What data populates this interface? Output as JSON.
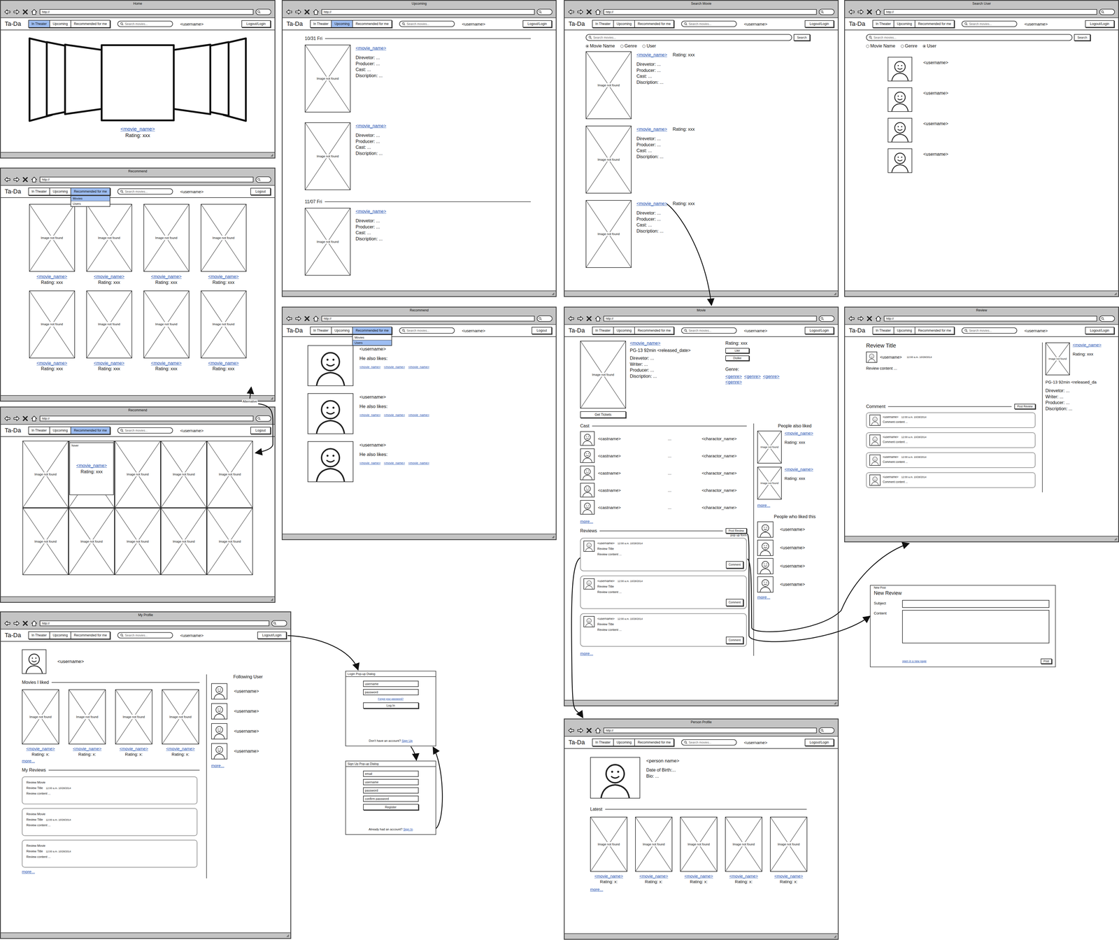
{
  "app": {
    "logo": "Ta-Da",
    "url": "http://",
    "search_placeholder": "Search movies...",
    "username": "<username>",
    "image_placeholder": "Image not found"
  },
  "annotations": {
    "alternative": "Alternative"
  },
  "windows": [
    {
      "kind": "home",
      "title": "Home",
      "tabs": [
        {
          "label": "In Theater",
          "selected": true
        },
        {
          "label": "Upcoming",
          "selected": false
        },
        {
          "label": "Recommended for me",
          "selected": false
        }
      ],
      "account_button": "Logout/Login",
      "featured": {
        "name": "<movie_name>",
        "rating": "Rating: xxx"
      }
    },
    {
      "kind": "recommend-movies",
      "title": "Recommend",
      "tabs": [
        {
          "label": "In Theater",
          "selected": false
        },
        {
          "label": "Upcoming",
          "selected": false
        },
        {
          "label": "Recommended for me",
          "selected": true
        }
      ],
      "account_button": "Logout",
      "menu": [
        {
          "label": "Movies",
          "selected": true
        },
        {
          "label": "Users",
          "selected": false
        }
      ],
      "movies": [
        {
          "name": "<movie_name>",
          "rating": "Rating: xxx"
        },
        {
          "name": "<movie_name>",
          "rating": "Rating: xxx"
        },
        {
          "name": "<movie_name>",
          "rating": "Rating: xxx"
        },
        {
          "name": "<movie_name>",
          "rating": "Rating: xxx"
        },
        {
          "name": "<movie_name>",
          "rating": "Rating: xxx"
        },
        {
          "name": "<movie_name>",
          "rating": "Rating: xxx"
        },
        {
          "name": "<movie_name>",
          "rating": "Rating: xxx"
        },
        {
          "name": "<movie_name>",
          "rating": "Rating: xxx"
        }
      ]
    },
    {
      "kind": "recommend-grid",
      "title": "Recommend",
      "tabs": [
        {
          "label": "In Theater",
          "selected": false
        },
        {
          "label": "Upcoming",
          "selected": false
        },
        {
          "label": "Recommended for me",
          "selected": true
        }
      ],
      "account_button": "Logout",
      "hover_label": "hover",
      "movies": [
        {
          "hovered": false
        },
        {
          "hovered": true,
          "name": "<movie_name>",
          "rating": "Rating: xxx"
        },
        {
          "hovered": false
        },
        {
          "hovered": false
        },
        {
          "hovered": false
        },
        {
          "hovered": false
        },
        {
          "hovered": false
        },
        {
          "hovered": false
        },
        {
          "hovered": false
        },
        {
          "hovered": false
        }
      ]
    },
    {
      "kind": "profile",
      "title": "My Profile",
      "tabs": [
        {
          "label": "In Theater",
          "selected": false
        },
        {
          "label": "Upcoming",
          "selected": false
        },
        {
          "label": "Recommended for me",
          "selected": false
        }
      ],
      "account_button": "Logout/Login",
      "user": "<username>",
      "liked_heading": "Movies I liked",
      "liked": [
        {
          "name": "<movie_name>",
          "rating": "Rating: x:"
        },
        {
          "name": "<movie_name>",
          "rating": "Rating: x:"
        },
        {
          "name": "<movie_name>",
          "rating": "Rating: x:"
        },
        {
          "name": "<movie_name>",
          "rating": "Rating: x:"
        }
      ],
      "liked_more": "more...",
      "reviews_heading": "My Reviews",
      "reviews": [
        {
          "movie": "Review Movie",
          "title": "Review Title",
          "time": "12:00 a.m. 10/28/2014",
          "content": "Review content ..."
        },
        {
          "movie": "Review Movie",
          "title": "Review Title",
          "time": "12:00 a.m. 10/28/2014",
          "content": "Review content ..."
        },
        {
          "movie": "Review Movie",
          "title": "Review Title",
          "time": "12:00 a.m. 10/28/2014",
          "content": "Review content ..."
        }
      ],
      "reviews_more": "more...",
      "following_heading": "Following User",
      "following": [
        {
          "name": "<username>"
        },
        {
          "name": "<username>"
        },
        {
          "name": "<username>"
        },
        {
          "name": "<username>"
        }
      ],
      "following_more": "more..."
    },
    {
      "kind": "upcoming",
      "title": "Upcoming",
      "tabs": [
        {
          "label": "In Theater",
          "selected": false
        },
        {
          "label": "Upcoming",
          "selected": true
        },
        {
          "label": "Recommended for me",
          "selected": false
        }
      ],
      "account_button": "Logout/Login",
      "days": [
        {
          "date": "10/31 Fri",
          "movies": [
            {
              "name": "<movie_name>",
              "details": [
                "Direvetor: ...",
                "Producer: ...",
                "Cast: ...",
                "Discription: ..."
              ]
            },
            {
              "name": "<movie_name>",
              "details": [
                "Direvetor: ...",
                "Producer: ...",
                "Cast: ...",
                "Discription: ..."
              ]
            }
          ]
        },
        {
          "date": "11/07 Fri",
          "movies": [
            {
              "name": "<movie_name>",
              "details": [
                "Direvetor: ...",
                "Producer: ...",
                "Cast: ...",
                "Discription: ..."
              ]
            }
          ]
        }
      ]
    },
    {
      "kind": "recommend-users",
      "title": "Recommend",
      "tabs": [
        {
          "label": "In Theater",
          "selected": false
        },
        {
          "label": "Upcoming",
          "selected": false
        },
        {
          "label": "Recommended for me",
          "selected": true
        }
      ],
      "account_button": "Logout",
      "menu": [
        {
          "label": "Movies",
          "selected": false
        },
        {
          "label": "Users",
          "selected": true
        }
      ],
      "users": [
        {
          "name": "<username>",
          "likes_label": "He also likes:",
          "likes": [
            "<movie_name>",
            "<movie_name>",
            "<movie_name>"
          ]
        },
        {
          "name": "<username>",
          "likes_label": "He also likes:",
          "likes": [
            "<movie_name>",
            "<movie_name>",
            "<movie_name>"
          ]
        },
        {
          "name": "<username>",
          "likes_label": "He also likes:",
          "likes": [
            "<movie_name>",
            "<movie_name>",
            "<movie_name>"
          ]
        }
      ]
    },
    {
      "kind": "search-movie",
      "title": "Search Movie",
      "tabs": [
        {
          "label": "In Theater",
          "selected": false
        },
        {
          "label": "Upcoming",
          "selected": false
        },
        {
          "label": "Recommended for me",
          "selected": false
        }
      ],
      "account_button": "Logout/Login",
      "search_button": "Search",
      "filters": [
        {
          "label": "Movie Name",
          "selected": true
        },
        {
          "label": "Genre",
          "selected": false
        },
        {
          "label": "User",
          "selected": false
        }
      ],
      "results": [
        {
          "name": "<movie_name>",
          "rating": "Rating: xxx",
          "details": [
            "Direvetor: ...",
            "Producer: ...",
            "Cast: ...",
            "Discription: ..."
          ]
        },
        {
          "name": "<movie_name>",
          "rating": "Rating: xxx",
          "details": [
            "Direvetor: ...",
            "Producer: ...",
            "Cast: ...",
            "Discription: ..."
          ]
        },
        {
          "name": "<movie_name>",
          "rating": "Rating: xxx",
          "details": [
            "Direvetor: ...",
            "Producer: ...",
            "Cast: ...",
            "Discription: ..."
          ]
        }
      ]
    },
    {
      "kind": "search-user",
      "title": "Search User",
      "tabs": [
        {
          "label": "In Theater",
          "selected": false
        },
        {
          "label": "Upcoming",
          "selected": false
        },
        {
          "label": "Recommended for me",
          "selected": false
        }
      ],
      "account_button": "Logout/Login",
      "search_button": "Search",
      "filters": [
        {
          "label": "Movie Name",
          "selected": false
        },
        {
          "label": "Genre",
          "selected": false
        },
        {
          "label": "User",
          "selected": true
        }
      ],
      "results": [
        {
          "name": "<username>"
        },
        {
          "name": "<username>"
        },
        {
          "name": "<username>"
        },
        {
          "name": "<username>"
        }
      ]
    },
    {
      "kind": "movie",
      "title": "Movie",
      "tabs": [
        {
          "label": "In Theater",
          "selected": false
        },
        {
          "label": "Upcoming",
          "selected": false
        },
        {
          "label": "Recommended for me",
          "selected": false
        }
      ],
      "account_button": "Logout/Login",
      "movie": {
        "name": "<movie_name>",
        "meta": "PG-13 92min <released_date>",
        "details": [
          "Direvetor: ...",
          "Writer: ...",
          "Producer: ...",
          "Discription: ..."
        ],
        "rating": "Rating: xxx",
        "like_button": "Like",
        "dislike_button": "Dislike",
        "genre_label": "Genre:",
        "genres": [
          "<genre>",
          "<genre>",
          "<genre>",
          "<genre>"
        ],
        "tickets_button": "Get Tickets"
      },
      "cast_heading": "Cast",
      "cast": [
        {
          "name": "<castname>",
          "sep": "...",
          "character": "<charactor_name>"
        },
        {
          "name": "<castname>",
          "sep": "...",
          "character": "<charactor_name>"
        },
        {
          "name": "<castname>",
          "sep": "...",
          "character": "<charactor_name>"
        },
        {
          "name": "<castname>",
          "sep": "...",
          "character": "<charactor_name>"
        },
        {
          "name": "<castname>",
          "sep": "...",
          "character": "<charactor_name>"
        }
      ],
      "cast_more": "more...",
      "reviews_heading": "Reviews",
      "post_button": "Post Review",
      "popup_note": "pop up form",
      "reviews": [
        {
          "user": "<username>",
          "time": "12:00 a.m. 10/28/2014",
          "title": "Review Title",
          "content": "Review content ...",
          "comment_button": "Comment"
        },
        {
          "user": "<username>",
          "time": "12:00 a.m. 10/28/2014",
          "title": "Review Title",
          "content": "Review content ...",
          "comment_button": "Comment"
        },
        {
          "user": "<username>",
          "time": "12:00 a.m. 10/28/2014",
          "title": "Review Title",
          "content": "Review content ...",
          "comment_button": "Comment"
        }
      ],
      "reviews_more": "more...",
      "also_liked_heading": "People also liked",
      "also_liked": [
        {
          "name": "<movie_name>",
          "rating": "Rating: xxx"
        },
        {
          "name": "<movie_name>",
          "rating": "Rating: xxx"
        }
      ],
      "also_liked_more": "more...",
      "liked_by_heading": "People who liked this",
      "liked_by": [
        {
          "name": "<username>"
        },
        {
          "name": "<username>"
        },
        {
          "name": "<username>"
        },
        {
          "name": "<username>"
        }
      ],
      "liked_by_more": "more..."
    },
    {
      "kind": "review",
      "title": "Review",
      "tabs": [
        {
          "label": "In Theater",
          "selected": false
        },
        {
          "label": "Upcoming",
          "selected": false
        },
        {
          "label": "Recommended for me",
          "selected": false
        }
      ],
      "account_button": "Logout/Login",
      "review": {
        "title": "Review Title",
        "user": "<username>",
        "time": "12:00 a.m. 10/28/2014",
        "content": "Review content ..."
      },
      "comment_heading": "Comment",
      "post_button": "Post Review",
      "comments": [
        {
          "user": "<username>",
          "time": "12:00 a.m. 10/28/2014",
          "content": "Comment content ..."
        },
        {
          "user": "<username>",
          "time": "12:00 a.m. 10/28/2014",
          "content": "Comment content ..."
        },
        {
          "user": "<username>",
          "time": "12:00 a.m. 10/28/2014",
          "content": "Comment content ..."
        },
        {
          "user": "<username>",
          "time": "12:00 a.m. 10/28/2014",
          "content": "Comment content ..."
        }
      ],
      "movie": {
        "name": "<movie_name>",
        "rating": "Rating: xxx",
        "meta": "PG-13 92min <released_da",
        "details": [
          "Direvetor: ...",
          "Writer: ...",
          "Producer: ...",
          "Discription: ..."
        ]
      }
    },
    {
      "kind": "person",
      "title": "Person Profile",
      "tabs": [
        {
          "label": "In Theater",
          "selected": false
        },
        {
          "label": "Upcoming",
          "selected": false
        },
        {
          "label": "Recommended for me",
          "selected": false
        }
      ],
      "account_button": "Logout/Login",
      "person": {
        "name": "<person name>",
        "details": [
          "Date of Birth:...",
          "Bio: ..."
        ]
      },
      "latest_heading": "Latest",
      "latest": [
        {
          "name": "<movie_name>",
          "rating": "Rating: x:"
        },
        {
          "name": "<movie_name>",
          "rating": "Rating: x:"
        },
        {
          "name": "<movie_name>",
          "rating": "Rating: x:"
        },
        {
          "name": "<movie_name>",
          "rating": "Rating: x:"
        },
        {
          "name": "<movie_name>",
          "rating": "Rating: x:"
        }
      ],
      "latest_more": "more..."
    }
  ],
  "dialogs": [
    {
      "kind": "login",
      "title": "Login Pop-up Dialog",
      "fields": [
        "username",
        "password"
      ],
      "forgot_link": "Forgot your password?",
      "submit": "Log In",
      "footer_text": "Don't have an account?",
      "footer_link": "Sign Up"
    },
    {
      "kind": "signup",
      "title": "Sign Up Pop-up Dialog",
      "fields": [
        "email",
        "username",
        "password",
        "confirm password"
      ],
      "submit": "Register",
      "footer_text": "Already had an account?",
      "footer_link": "Sign In"
    }
  ],
  "new_post": {
    "legend": "New Post",
    "heading": "New Review",
    "subject_label": "Subject",
    "content_label": "Content",
    "open_link": "open in a new page",
    "submit": "Post"
  }
}
